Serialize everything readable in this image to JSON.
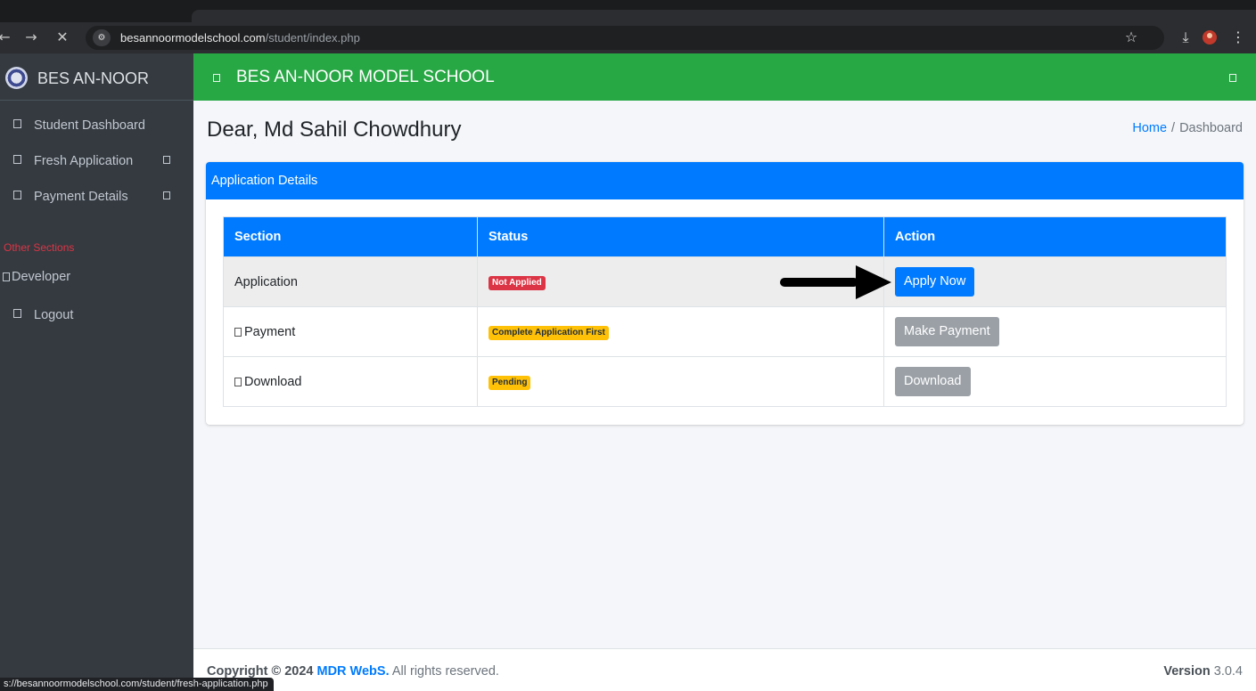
{
  "browser": {
    "url_domain": "besannoormodelschool.com",
    "url_path": "/student/index.php",
    "status_url": "s://besannoormodelschool.com/student/fresh-application.php",
    "icons": [
      "back-arrow-icon",
      "forward-arrow-icon",
      "close-icon",
      "site-settings-icon",
      "star-icon",
      "download-icon",
      "profile-icon",
      "menu-icon"
    ]
  },
  "sidebar": {
    "brand": "BES AN-NOOR",
    "items": [
      {
        "label": "Student Dashboard"
      },
      {
        "label": "Fresh Application"
      },
      {
        "label": "Payment Details"
      }
    ],
    "section_header": "Other Sections",
    "developer": "Developer",
    "logout": "Logout"
  },
  "header": {
    "title": "BES AN-NOOR MODEL SCHOOL"
  },
  "main": {
    "greeting": "Dear, Md Sahil Chowdhury",
    "breadcrumb": {
      "home": "Home",
      "sep": "/",
      "current": "Dashboard"
    },
    "card_title": "Application Details",
    "table": {
      "headers": [
        "Section",
        "Status",
        "Action"
      ],
      "rows": [
        {
          "section": "Application",
          "status": "Not Applied",
          "action": "Apply Now"
        },
        {
          "section": "Payment",
          "status": "Complete Application First",
          "action": "Make Payment"
        },
        {
          "section": "Download",
          "status": "Pending",
          "action": "Download"
        }
      ]
    }
  },
  "footer": {
    "copyright_prefix": "Copyright © 2024",
    "company": "MDR WebS.",
    "rights": "All rights reserved.",
    "version_label": "Version",
    "version": "3.0.4"
  },
  "colors": {
    "primary": "#007bff",
    "header_green": "#28a745",
    "sidebar": "#343a40",
    "danger": "#dc3545",
    "warning": "#ffc107",
    "secondary": "#9aa0a6"
  }
}
